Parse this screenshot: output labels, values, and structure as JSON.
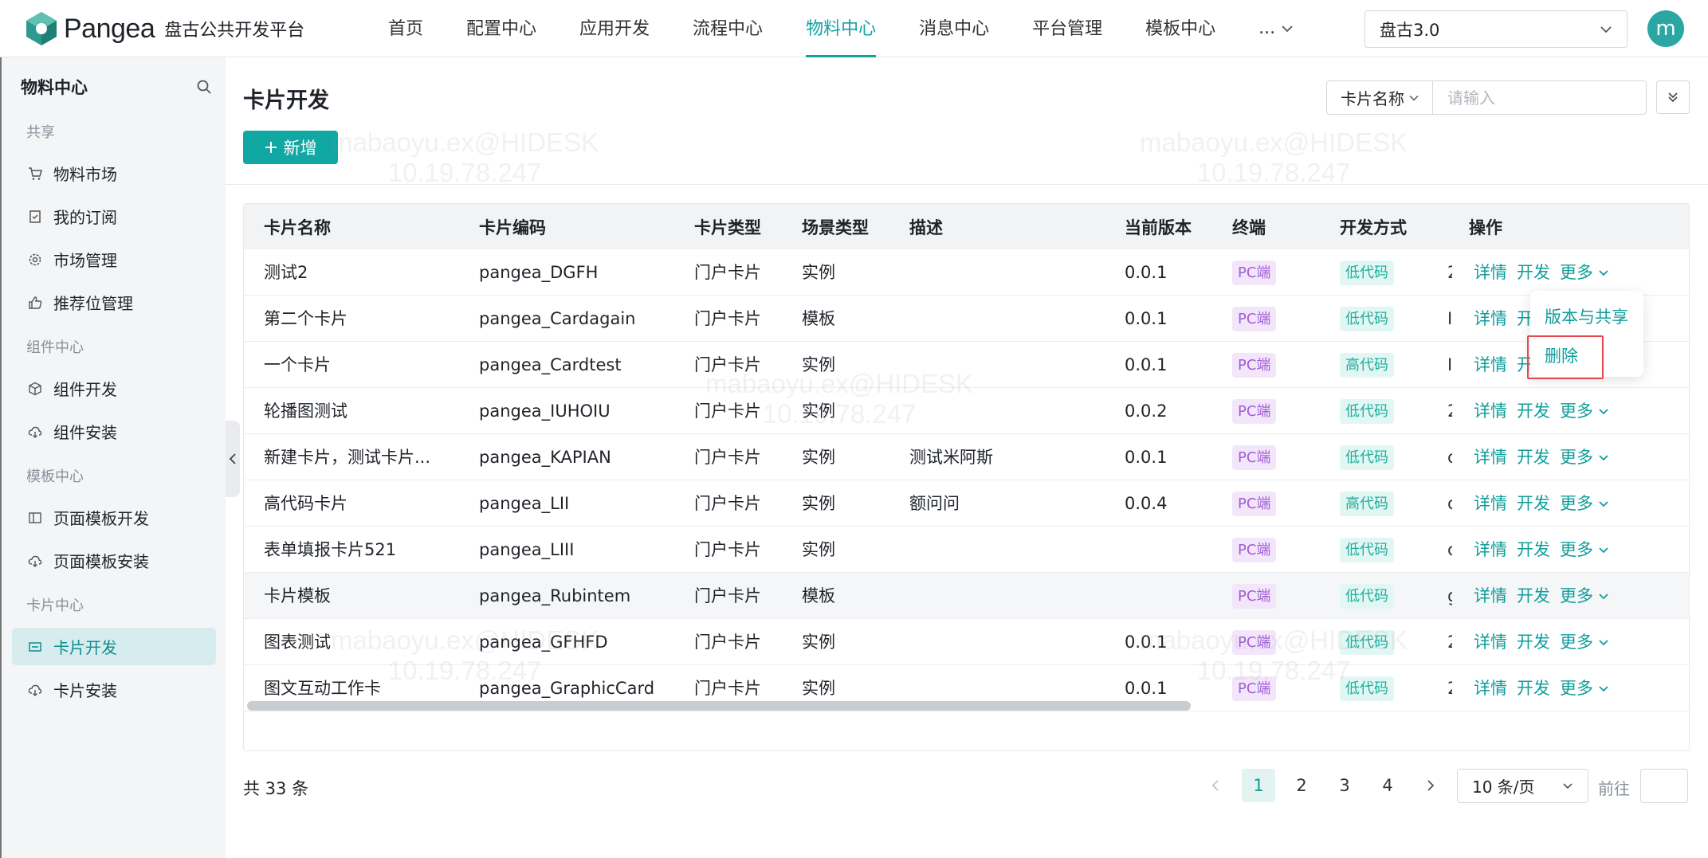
{
  "header": {
    "logo_text": "Pangea",
    "platform_name": "盘古公共开发平台",
    "nav": [
      {
        "label": "首页"
      },
      {
        "label": "配置中心"
      },
      {
        "label": "应用开发"
      },
      {
        "label": "流程中心"
      },
      {
        "label": "物料中心",
        "active": true
      },
      {
        "label": "消息中心"
      },
      {
        "label": "平台管理"
      },
      {
        "label": "模板中心"
      }
    ],
    "nav_more": "...",
    "env_value": "盘古3.0",
    "avatar_letter": "m"
  },
  "sidebar": {
    "title": "物料中心",
    "groups": {
      "share": "共享",
      "component": "组件中心",
      "template": "模板中心",
      "card": "卡片中心"
    },
    "items": {
      "market": "物料市场",
      "subscription": "我的订阅",
      "market_manage": "市场管理",
      "recommend": "推荐位管理",
      "component_dev": "组件开发",
      "component_install": "组件安装",
      "page_template_dev": "页面模板开发",
      "page_template_install": "页面模板安装",
      "card_dev": "卡片开发",
      "card_install": "卡片安装"
    }
  },
  "main": {
    "title": "卡片开发",
    "search_type": "卡片名称",
    "search_placeholder": "请输入",
    "add_label": "新增"
  },
  "table": {
    "columns": {
      "name": "卡片名称",
      "code": "卡片编码",
      "card_type": "卡片类型",
      "scene_type": "场景类型",
      "desc": "描述",
      "version": "当前版本",
      "terminal": "终端",
      "dev_mode": "开发方式",
      "ops": "操作"
    },
    "rows": [
      {
        "name": "测试2",
        "code": "pangea_DGFH",
        "card_type": "门户卡片",
        "scene_type": "实例",
        "desc": "",
        "version": "0.0.1",
        "terminal": "PC端",
        "dev_mode": "低代码",
        "cut": "2"
      },
      {
        "name": "第二个卡片",
        "code": "pangea_Cardagain",
        "card_type": "门户卡片",
        "scene_type": "模板",
        "desc": "",
        "version": "0.0.1",
        "terminal": "PC端",
        "dev_mode": "低代码",
        "cut": "I"
      },
      {
        "name": "一个卡片",
        "code": "pangea_Cardtest",
        "card_type": "门户卡片",
        "scene_type": "实例",
        "desc": "",
        "version": "0.0.1",
        "terminal": "PC端",
        "dev_mode": "高代码",
        "cut": "I"
      },
      {
        "name": "轮播图测试",
        "code": "pangea_IUHOIU",
        "card_type": "门户卡片",
        "scene_type": "实例",
        "desc": "",
        "version": "0.0.2",
        "terminal": "PC端",
        "dev_mode": "低代码",
        "cut": "2"
      },
      {
        "name": "新建卡片，测试卡片...",
        "code": "pangea_KAPIAN",
        "card_type": "门户卡片",
        "scene_type": "实例",
        "desc": "测试米阿斯",
        "version": "0.0.1",
        "terminal": "PC端",
        "dev_mode": "低代码",
        "cut": "c"
      },
      {
        "name": "高代码卡片",
        "code": "pangea_LII",
        "card_type": "门户卡片",
        "scene_type": "实例",
        "desc": "额问问",
        "version": "0.0.4",
        "terminal": "PC端",
        "dev_mode": "高代码",
        "cut": "c"
      },
      {
        "name": "表单填报卡片521",
        "code": "pangea_LIII",
        "card_type": "门户卡片",
        "scene_type": "实例",
        "desc": "",
        "version": "",
        "terminal": "PC端",
        "dev_mode": "低代码",
        "cut": "c"
      },
      {
        "name": "卡片模板",
        "code": "pangea_Rubintem",
        "card_type": "门户卡片",
        "scene_type": "模板",
        "desc": "",
        "version": "",
        "terminal": "PC端",
        "dev_mode": "低代码",
        "cut": "g"
      },
      {
        "name": "图表测试",
        "code": "pangea_GFHFD",
        "card_type": "门户卡片",
        "scene_type": "实例",
        "desc": "",
        "version": "0.0.1",
        "terminal": "PC端",
        "dev_mode": "低代码",
        "cut": "2"
      },
      {
        "name": "图文互动工作卡",
        "code": "pangea_GraphicCard",
        "card_type": "门户卡片",
        "scene_type": "实例",
        "desc": "",
        "version": "0.0.1",
        "terminal": "PC端",
        "dev_mode": "低代码",
        "cut": "2"
      }
    ],
    "ops": {
      "detail": "详情",
      "develop": "开发",
      "more": "更多"
    },
    "partial_ops": {
      "develop_cut": "开"
    }
  },
  "dropdown": {
    "version_share": "版本与共享",
    "delete": "删除"
  },
  "pagination": {
    "total": "共 33 条",
    "pages": [
      "1",
      "2",
      "3",
      "4"
    ],
    "current": "1",
    "page_size": "10 条/页",
    "goto_label": "前往"
  },
  "watermark": {
    "user": "mabaoyu.ex@HIDESK",
    "ip": "10.19.78.247"
  },
  "colors": {
    "accent": "#0fa3a0",
    "primary_button": "#11a7a3",
    "pc_tag": "#a05ed6",
    "dev_tag": "#1fae9c",
    "highlight_border": "#e5484d"
  }
}
